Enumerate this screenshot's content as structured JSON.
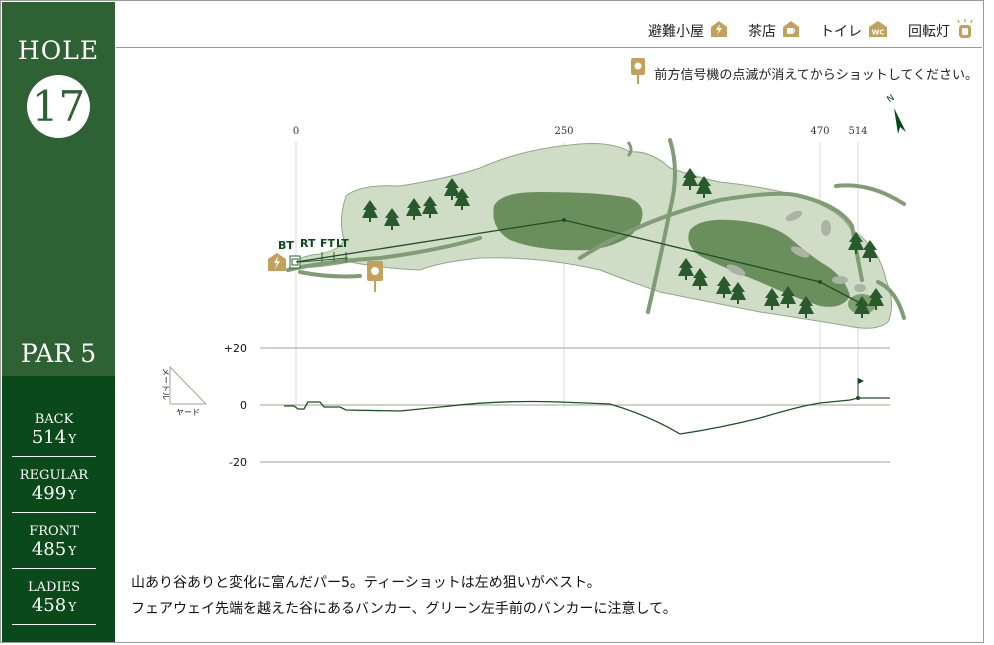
{
  "hole": {
    "label": "HOLE",
    "number": "17",
    "par": "PAR 5"
  },
  "tees": [
    {
      "name": "BACK",
      "yards": "514",
      "unit": "Y"
    },
    {
      "name": "REGULAR",
      "yards": "499",
      "unit": "Y"
    },
    {
      "name": "FRONT",
      "yards": "485",
      "unit": "Y"
    },
    {
      "name": "LADIES",
      "yards": "458",
      "unit": "Y"
    }
  ],
  "legend": [
    {
      "label": "避難小屋",
      "icon": "shelter-lightning-icon"
    },
    {
      "label": "茶店",
      "icon": "teahouse-cup-icon"
    },
    {
      "label": "トイレ",
      "icon": "toilet-wc-icon"
    },
    {
      "label": "回転灯",
      "icon": "rotating-light-icon"
    }
  ],
  "notice": "前方信号機の点滅が消えてからショットしてください。",
  "distance_markers": [
    "0",
    "250",
    "470",
    "514"
  ],
  "tee_markers": [
    "BT",
    "RT",
    "FT",
    "LT"
  ],
  "compass": "N",
  "elevation": {
    "labels": [
      "+20",
      "0",
      "-20"
    ],
    "axis_meter": "メートル",
    "axis_yard": "ヤード"
  },
  "description": [
    "山あり谷ありと変化に富んだパー5。ティーショットは左め狙いがベスト。",
    "フェアウェイ先端を越えた谷にあるバンカー、グリーン左手前のバンカーに注意して。"
  ],
  "colors": {
    "side_green": "#2e6133",
    "side_dark": "#0a4a1a",
    "gold": "#c4a15a",
    "rough": "#cfdcc6",
    "fairway": "#6b8f5c",
    "tree": "#285a2e",
    "path": "#7f9c74"
  }
}
